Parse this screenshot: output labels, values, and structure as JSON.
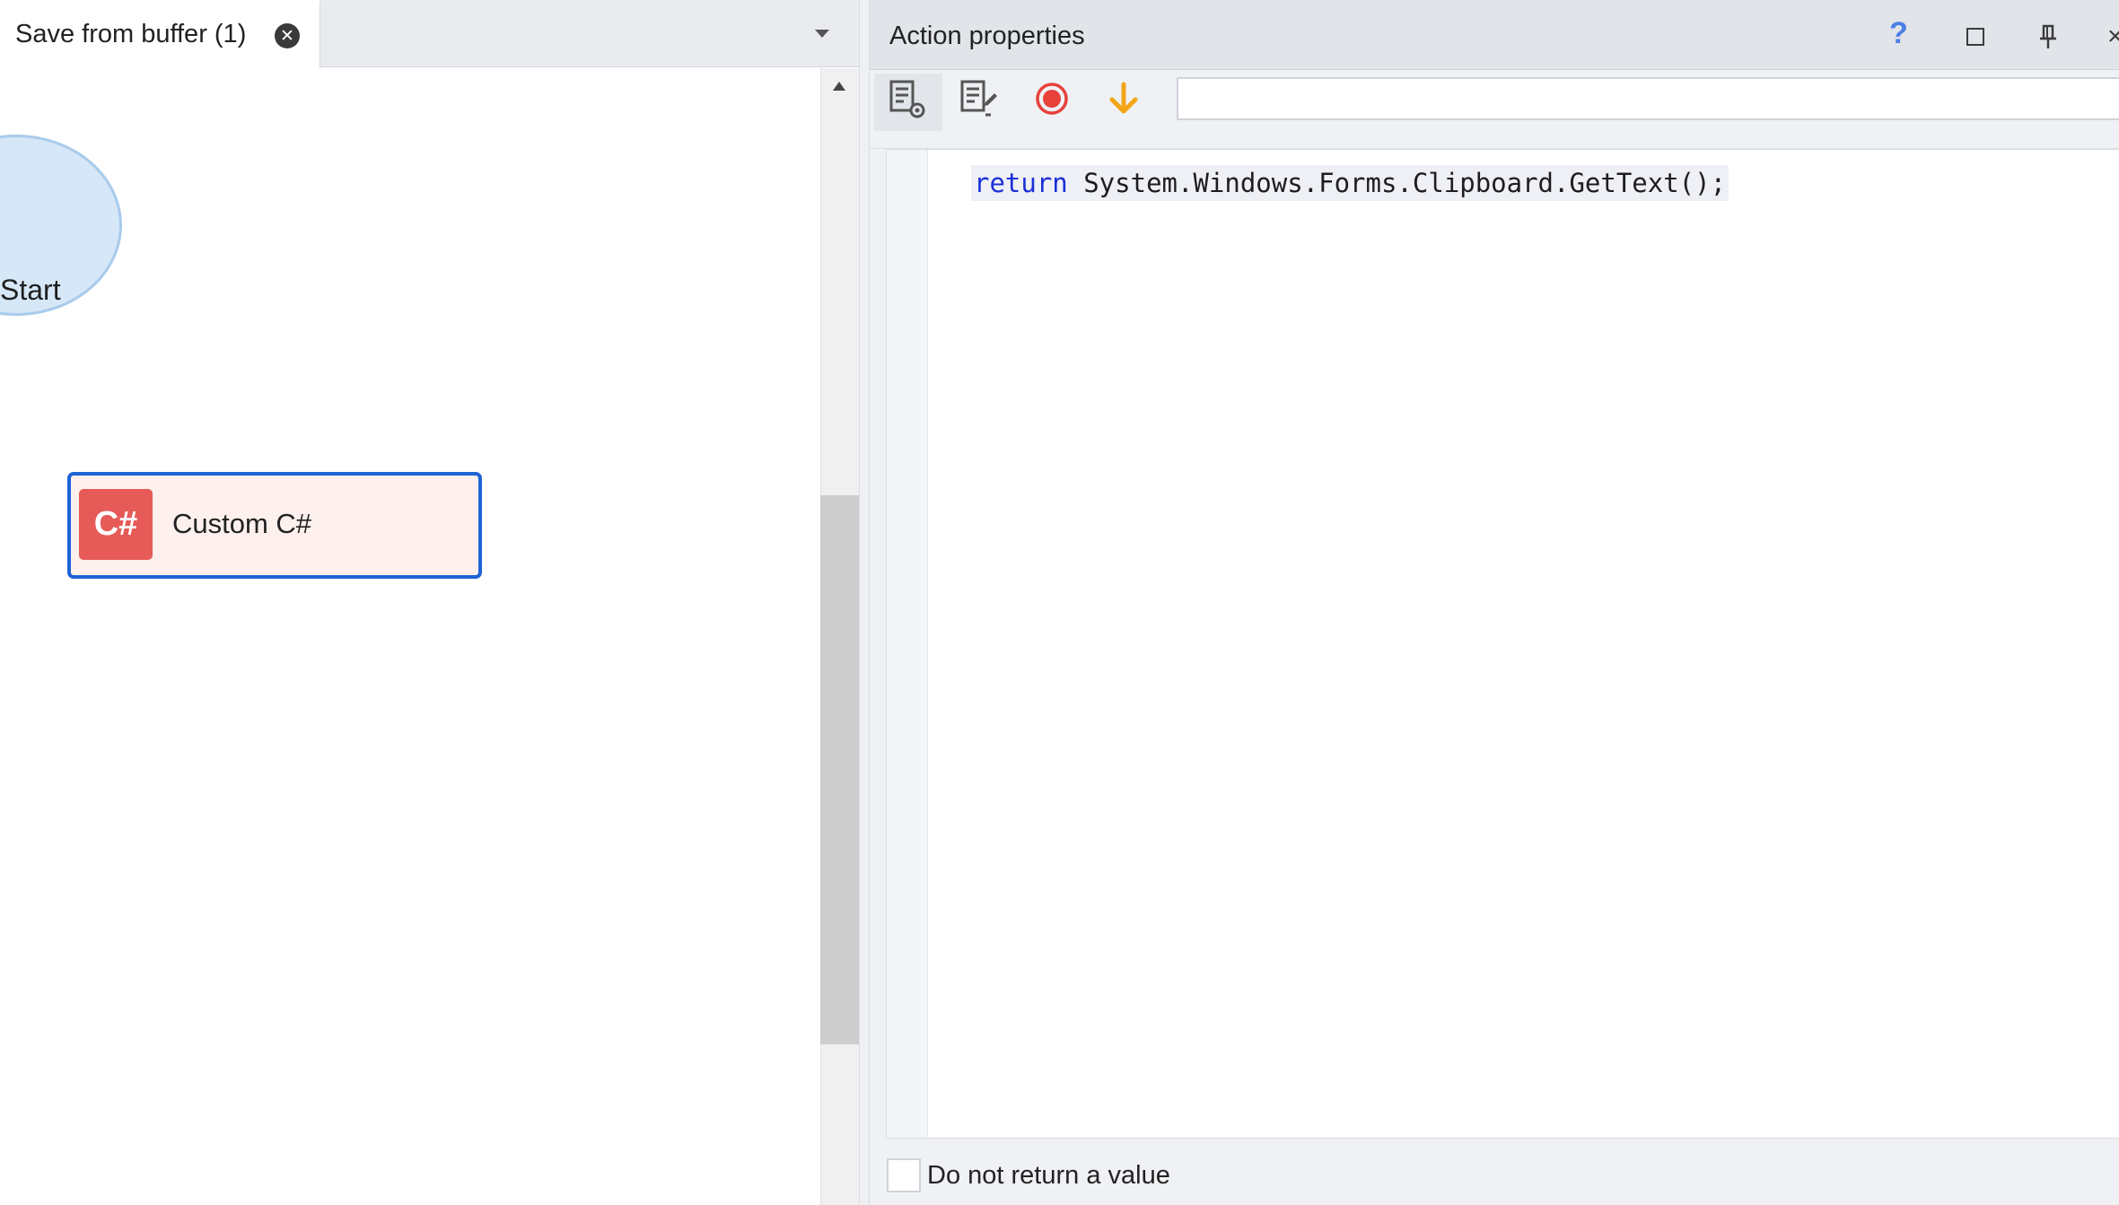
{
  "document_tab": {
    "title": "Save from buffer (1)",
    "close_glyph": "✕"
  },
  "canvas": {
    "start_node": {
      "label": "Start"
    },
    "action_node": {
      "badge": "C#",
      "label": "Custom C#",
      "border_color": "#1e63d6",
      "badge_color": "#e65b57"
    }
  },
  "properties_panel": {
    "title": "Action properties",
    "help_glyph": "?",
    "close_glyph": "×",
    "toolbar": {
      "icons": [
        "settings-list-icon",
        "edit-list-icon",
        "record-icon",
        "arrow-down-icon"
      ],
      "input_value": ""
    },
    "code": {
      "keyword": "return",
      "rest": " System.Windows.Forms.Clipboard.GetText();"
    },
    "checkbox": {
      "label": "Do not return a value",
      "checked": false
    }
  },
  "colors": {
    "accent_blue": "#1e63d6",
    "record_red": "#e8403b",
    "arrow_orange": "#f2a516",
    "keyword_blue": "#1c2fd6"
  }
}
